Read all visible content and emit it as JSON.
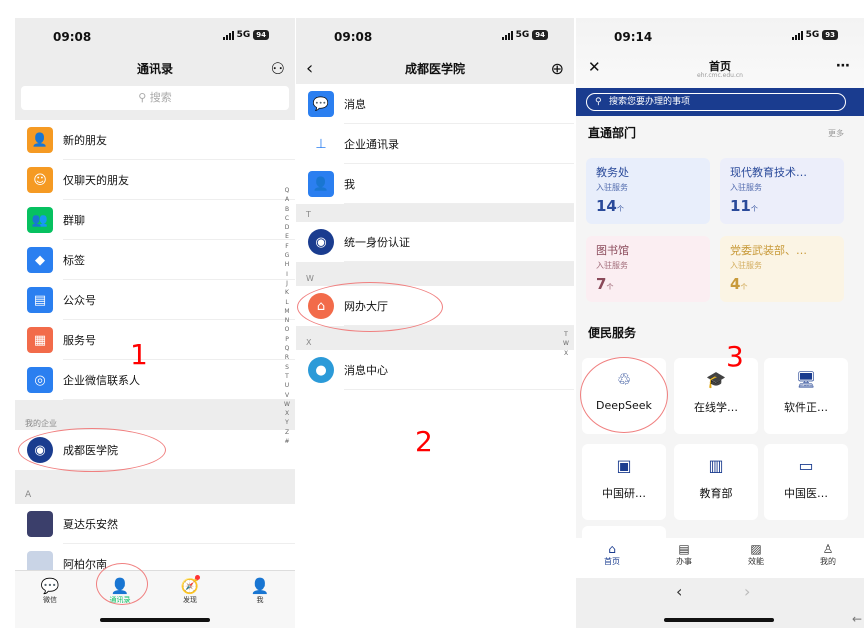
{
  "phone1": {
    "time": "09:08",
    "network": "5G",
    "battery": "94",
    "title": "通讯录",
    "search_placeholder": "搜索",
    "items": [
      {
        "label": "新的朋友",
        "color": "#f59a23",
        "icon": "add-friend-icon",
        "glyph": "👤"
      },
      {
        "label": "仅聊天的朋友",
        "color": "#f59a23",
        "icon": "chat-friend-icon",
        "glyph": "☺"
      },
      {
        "label": "群聊",
        "color": "#07c160",
        "icon": "group-chat-icon",
        "glyph": "👥"
      },
      {
        "label": "标签",
        "color": "#2b7ff0",
        "icon": "tag-icon",
        "glyph": "◆"
      },
      {
        "label": "公众号",
        "color": "#2b7ff0",
        "icon": "official-account-icon",
        "glyph": "▤"
      },
      {
        "label": "服务号",
        "color": "#f26b4a",
        "icon": "service-account-icon",
        "glyph": "▦"
      },
      {
        "label": "企业微信联系人",
        "color": "#2b7ff0",
        "icon": "wecom-contact-icon",
        "glyph": "◎"
      }
    ],
    "enterprise_header": "我的企业",
    "enterprise_item": "成都医学院",
    "section_a": "A",
    "contact_a1": "夏达乐安然",
    "contact_a2": "阿柏尔南",
    "index_letters": [
      "Q",
      "A",
      "B",
      "C",
      "D",
      "E",
      "F",
      "G",
      "H",
      "I",
      "J",
      "K",
      "L",
      "M",
      "N",
      "O",
      "P",
      "Q",
      "R",
      "S",
      "T",
      "U",
      "V",
      "W",
      "X",
      "Y",
      "Z",
      "#"
    ],
    "tabs": [
      {
        "label": "微信",
        "icon": "chat-tab-icon",
        "glyph": "💬"
      },
      {
        "label": "通讯录",
        "icon": "contacts-tab-icon",
        "glyph": "👤"
      },
      {
        "label": "发现",
        "icon": "discover-tab-icon",
        "glyph": "🧭"
      },
      {
        "label": "我",
        "icon": "me-tab-icon",
        "glyph": "👤"
      }
    ],
    "annotation": "1"
  },
  "phone2": {
    "time": "09:08",
    "network": "5G",
    "battery": "94",
    "title": "成都医学院",
    "items_top": [
      {
        "label": "消息",
        "color": "#2b7ff0",
        "icon": "message-icon",
        "glyph": "💬"
      },
      {
        "label": "企业通讯录",
        "color": "#ffffff",
        "icon": "org-chart-icon",
        "glyph": "⊥"
      },
      {
        "label": "我",
        "color": "#2b7ff0",
        "icon": "me-icon",
        "glyph": "👤"
      }
    ],
    "section_t": "T",
    "item_t": "统一身份认证",
    "section_w": "W",
    "item_w": "网办大厅",
    "section_x": "X",
    "item_x": "消息中心",
    "side_index": [
      "T",
      "W",
      "X"
    ],
    "annotation": "2"
  },
  "phone3": {
    "time": "09:14",
    "network": "5G",
    "battery": "93",
    "title": "首页",
    "subtitle": "ehr.cmc.edu.cn",
    "search_placeholder": "搜索您要办理的事项",
    "dept_title": "直通部门",
    "more": "更多",
    "depts": [
      {
        "name": "教务处",
        "sub": "入驻服务",
        "count": "14",
        "unit": "个",
        "bg": "#e8eefb",
        "fg": "#2a4a9a"
      },
      {
        "name": "现代教育技术…",
        "sub": "入驻服务",
        "count": "11",
        "unit": "个",
        "bg": "#eceefa",
        "fg": "#2a4a9a"
      },
      {
        "name": "图书馆",
        "sub": "入驻服务",
        "count": "7",
        "unit": "个",
        "bg": "#fbeef2",
        "fg": "#8a4a5a"
      },
      {
        "name": "党委武装部、…",
        "sub": "入驻服务",
        "count": "4",
        "unit": "个",
        "bg": "#fbf4e4",
        "fg": "#c89a3a"
      }
    ],
    "service_title": "便民服务",
    "services": [
      {
        "label": "DeepSeek",
        "icon": "deepseek-icon",
        "glyph": "♲"
      },
      {
        "label": "在线学…",
        "icon": "graduation-cap-icon",
        "glyph": "🎓"
      },
      {
        "label": "软件正…",
        "icon": "monitor-icon",
        "glyph": "🖥"
      },
      {
        "label": "中国研…",
        "icon": "portrait-icon",
        "glyph": "▣"
      },
      {
        "label": "教育部",
        "icon": "building-icon",
        "glyph": "▥"
      },
      {
        "label": "中国医…",
        "icon": "desktop-icon",
        "glyph": "▭"
      }
    ],
    "tabs": [
      {
        "label": "首页",
        "icon": "home-tab-icon",
        "glyph": "⌂"
      },
      {
        "label": "办事",
        "icon": "tasks-tab-icon",
        "glyph": "▤"
      },
      {
        "label": "效能",
        "icon": "chart-tab-icon",
        "glyph": "▨"
      },
      {
        "label": "我的",
        "icon": "profile-tab-icon",
        "glyph": "♙"
      }
    ],
    "annotation": "3"
  }
}
